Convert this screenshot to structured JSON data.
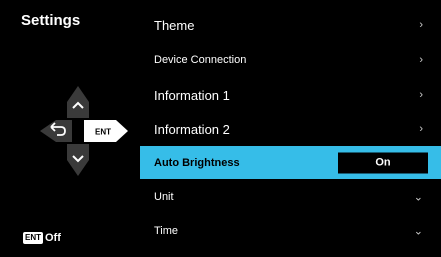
{
  "header": {
    "title": "Settings"
  },
  "menu": {
    "items": [
      {
        "label": "Theme",
        "indicator": "chevron-right"
      },
      {
        "label": "Device Connection",
        "indicator": "chevron-right"
      },
      {
        "label": "Information 1",
        "indicator": "chevron-right"
      },
      {
        "label": "Information 2",
        "indicator": "chevron-right"
      },
      {
        "label": "Auto Brightness",
        "value": "On",
        "selected": true
      },
      {
        "label": "Unit",
        "indicator": "chevron-down"
      },
      {
        "label": "Time",
        "indicator": "chevron-down"
      }
    ]
  },
  "dpad": {
    "center_label": "ENT"
  },
  "footer": {
    "key_label": "ENT",
    "action_label": "Off"
  },
  "colors": {
    "selection": "#36bde8",
    "background": "#000000",
    "dpad_button": "#3a3a3a"
  }
}
